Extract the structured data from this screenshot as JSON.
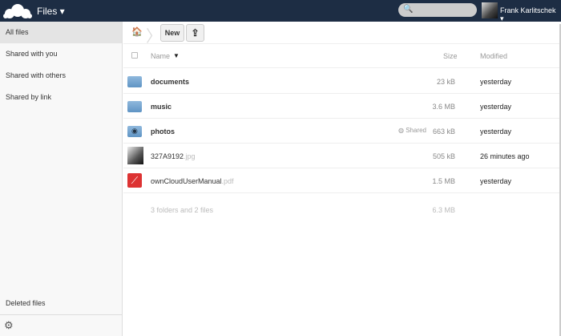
{
  "header": {
    "app_name": "Files ▾",
    "user": "Frank Karlitschek ▾",
    "search_icon": "🔍"
  },
  "sidebar": {
    "items": [
      {
        "label": "All files"
      },
      {
        "label": "Shared with you"
      },
      {
        "label": "Shared with others"
      },
      {
        "label": "Shared by link"
      }
    ],
    "deleted": "Deleted files",
    "settings_icon": "⚙"
  },
  "controls": {
    "home_icon": "🏠",
    "new_label": "New",
    "upload_icon": "⇪"
  },
  "table": {
    "name_header": "Name",
    "sort_icon": "▼",
    "size_header": "Size",
    "modified_header": "Modified",
    "rows": [
      {
        "name": "documents",
        "ext": "",
        "size": "23 kB",
        "modified": "yesterday",
        "bold": true,
        "shared": ""
      },
      {
        "name": "music",
        "ext": "",
        "size": "3.6 MB",
        "modified": "yesterday",
        "bold": true,
        "shared": ""
      },
      {
        "name": "photos",
        "ext": "",
        "size": "663 kB",
        "modified": "yesterday",
        "bold": true,
        "shared": "Shared"
      },
      {
        "name": "327A9192",
        "ext": ".jpg",
        "size": "505 kB",
        "modified": "26 minutes ago",
        "bold": false,
        "shared": ""
      },
      {
        "name": "ownCloudUserManual",
        "ext": ".pdf",
        "size": "1.5 MB",
        "modified": "yesterday",
        "bold": false,
        "shared": ""
      }
    ],
    "summary": "3 folders and 2 files",
    "total": "6.3 MB"
  }
}
